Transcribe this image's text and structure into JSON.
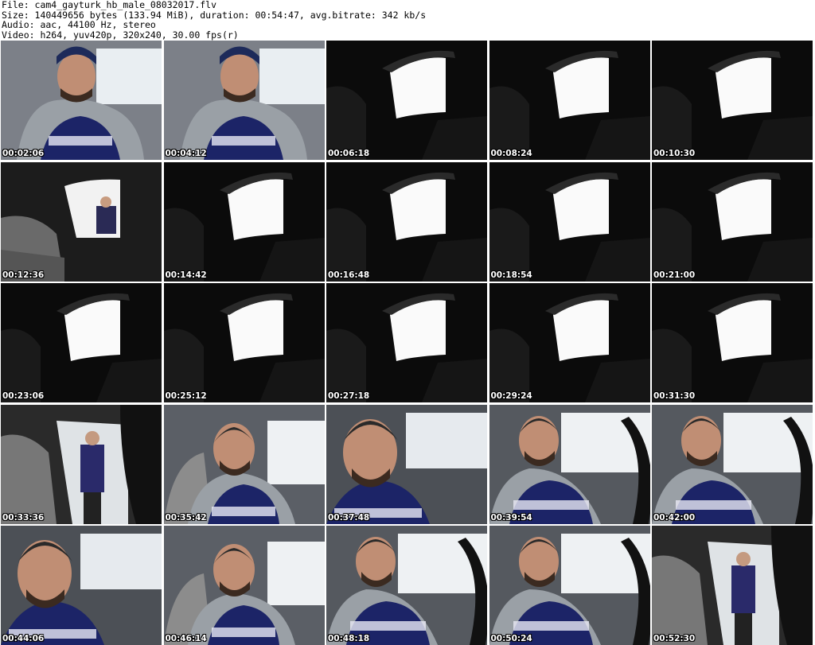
{
  "header": {
    "file_line": "File: cam4_gayturk_hb_male_08032017.flv",
    "size_line": "Size: 140449656 bytes (133.94 MiB), duration: 00:54:47, avg.bitrate: 342 kb/s",
    "audio_line": "Audio: aac, 44100 Hz, stereo",
    "video_line": "Video: h264, yuv420p, 320x240, 30.00 fps(r)"
  },
  "thumbnails": [
    {
      "time": "00:02:06",
      "scene": "person-hoodie"
    },
    {
      "time": "00:04:12",
      "scene": "person-hoodie"
    },
    {
      "time": "00:06:18",
      "scene": "dark-window"
    },
    {
      "time": "00:08:24",
      "scene": "dark-window"
    },
    {
      "time": "00:10:30",
      "scene": "dark-window"
    },
    {
      "time": "00:12:36",
      "scene": "window-person-outside"
    },
    {
      "time": "00:14:42",
      "scene": "dark-window"
    },
    {
      "time": "00:16:48",
      "scene": "dark-window"
    },
    {
      "time": "00:18:54",
      "scene": "dark-window"
    },
    {
      "time": "00:21:00",
      "scene": "dark-window"
    },
    {
      "time": "00:23:06",
      "scene": "dark-window"
    },
    {
      "time": "00:25:12",
      "scene": "dark-window"
    },
    {
      "time": "00:27:18",
      "scene": "dark-window"
    },
    {
      "time": "00:29:24",
      "scene": "dark-window"
    },
    {
      "time": "00:31:30",
      "scene": "dark-window"
    },
    {
      "time": "00:33:36",
      "scene": "door-person-standing"
    },
    {
      "time": "00:35:42",
      "scene": "person-car-seat"
    },
    {
      "time": "00:37:48",
      "scene": "person-closeup"
    },
    {
      "time": "00:39:54",
      "scene": "person-steering"
    },
    {
      "time": "00:42:00",
      "scene": "person-steering"
    },
    {
      "time": "00:44:06",
      "scene": "person-closeup"
    },
    {
      "time": "00:46:14",
      "scene": "person-car-seat"
    },
    {
      "time": "00:48:18",
      "scene": "person-steering"
    },
    {
      "time": "00:50:24",
      "scene": "person-steering"
    },
    {
      "time": "00:52:30",
      "scene": "door-person-standing"
    }
  ]
}
